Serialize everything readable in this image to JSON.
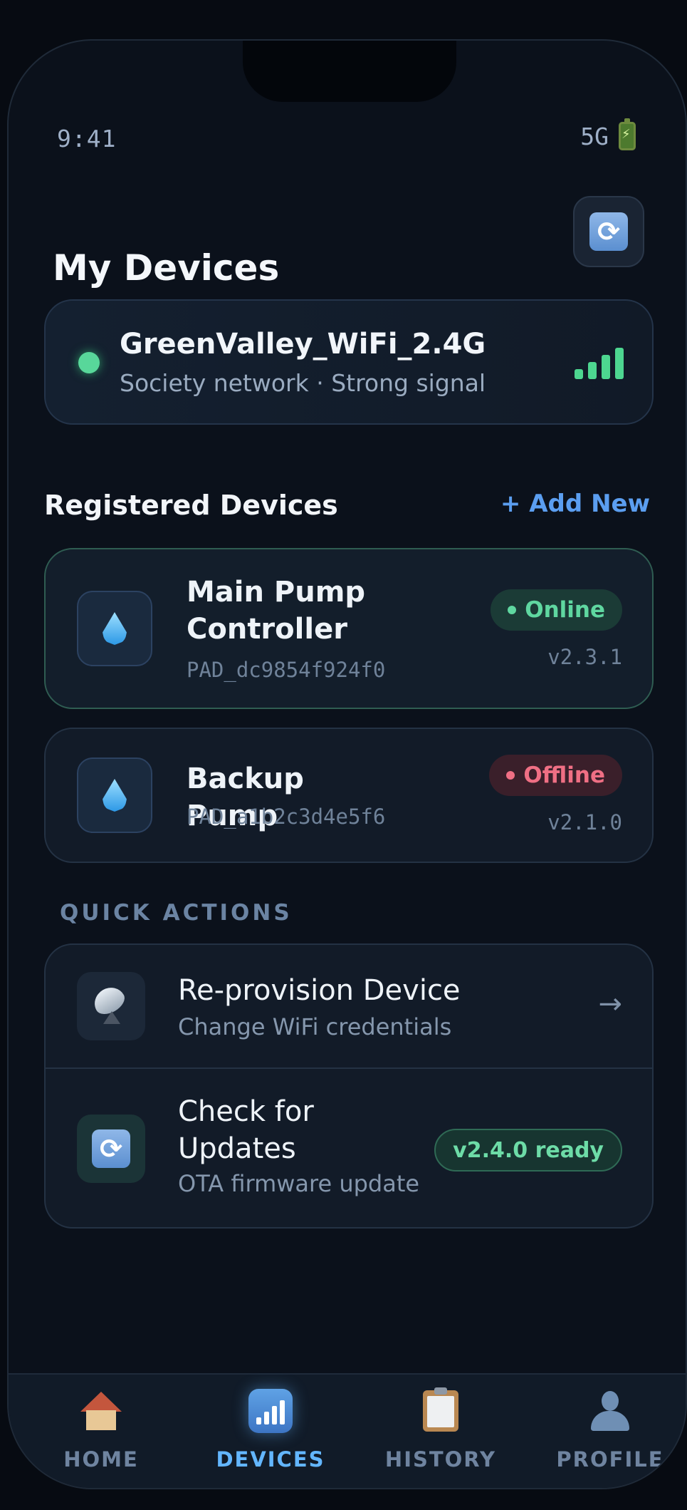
{
  "status_bar": {
    "time": "9:41",
    "network": "5G"
  },
  "header": {
    "title": "My Devices"
  },
  "wifi": {
    "ssid": "GreenValley_WiFi_2.4G",
    "subtitle": "Society network · Strong signal",
    "signal_level": 4,
    "status_color": "#58d79a"
  },
  "registered": {
    "title": "Registered Devices",
    "add_label": "+ Add New"
  },
  "devices": [
    {
      "name": "Main Pump Controller",
      "id": "PAD_dc9854f924f0",
      "status": "Online",
      "version": "v2.3.1",
      "icon": "water-drop-icon"
    },
    {
      "name": "Backup Pump",
      "id": "PAD_a1b2c3d4e5f6",
      "status": "Offline",
      "version": "v2.1.0",
      "icon": "water-drop-icon"
    }
  ],
  "quick_actions": {
    "title": "QUICK ACTIONS",
    "items": [
      {
        "label": "Re-provision Device",
        "sub": "Change WiFi credentials",
        "icon": "satellite-dish-icon",
        "arrow": "→"
      },
      {
        "label": "Check for Updates",
        "sub": "OTA firmware update",
        "icon": "sync-icon",
        "badge": "v2.4.0 ready"
      }
    ]
  },
  "tabs": [
    {
      "label": "HOME",
      "icon": "house-icon"
    },
    {
      "label": "DEVICES",
      "icon": "bar-chart-icon",
      "active": true
    },
    {
      "label": "HISTORY",
      "icon": "clipboard-icon"
    },
    {
      "label": "PROFILE",
      "icon": "person-icon"
    }
  ],
  "colors": {
    "accent": "#63b6ff",
    "online": "#5fd7a0",
    "offline": "#ef6f84",
    "background": "#0b111b"
  }
}
